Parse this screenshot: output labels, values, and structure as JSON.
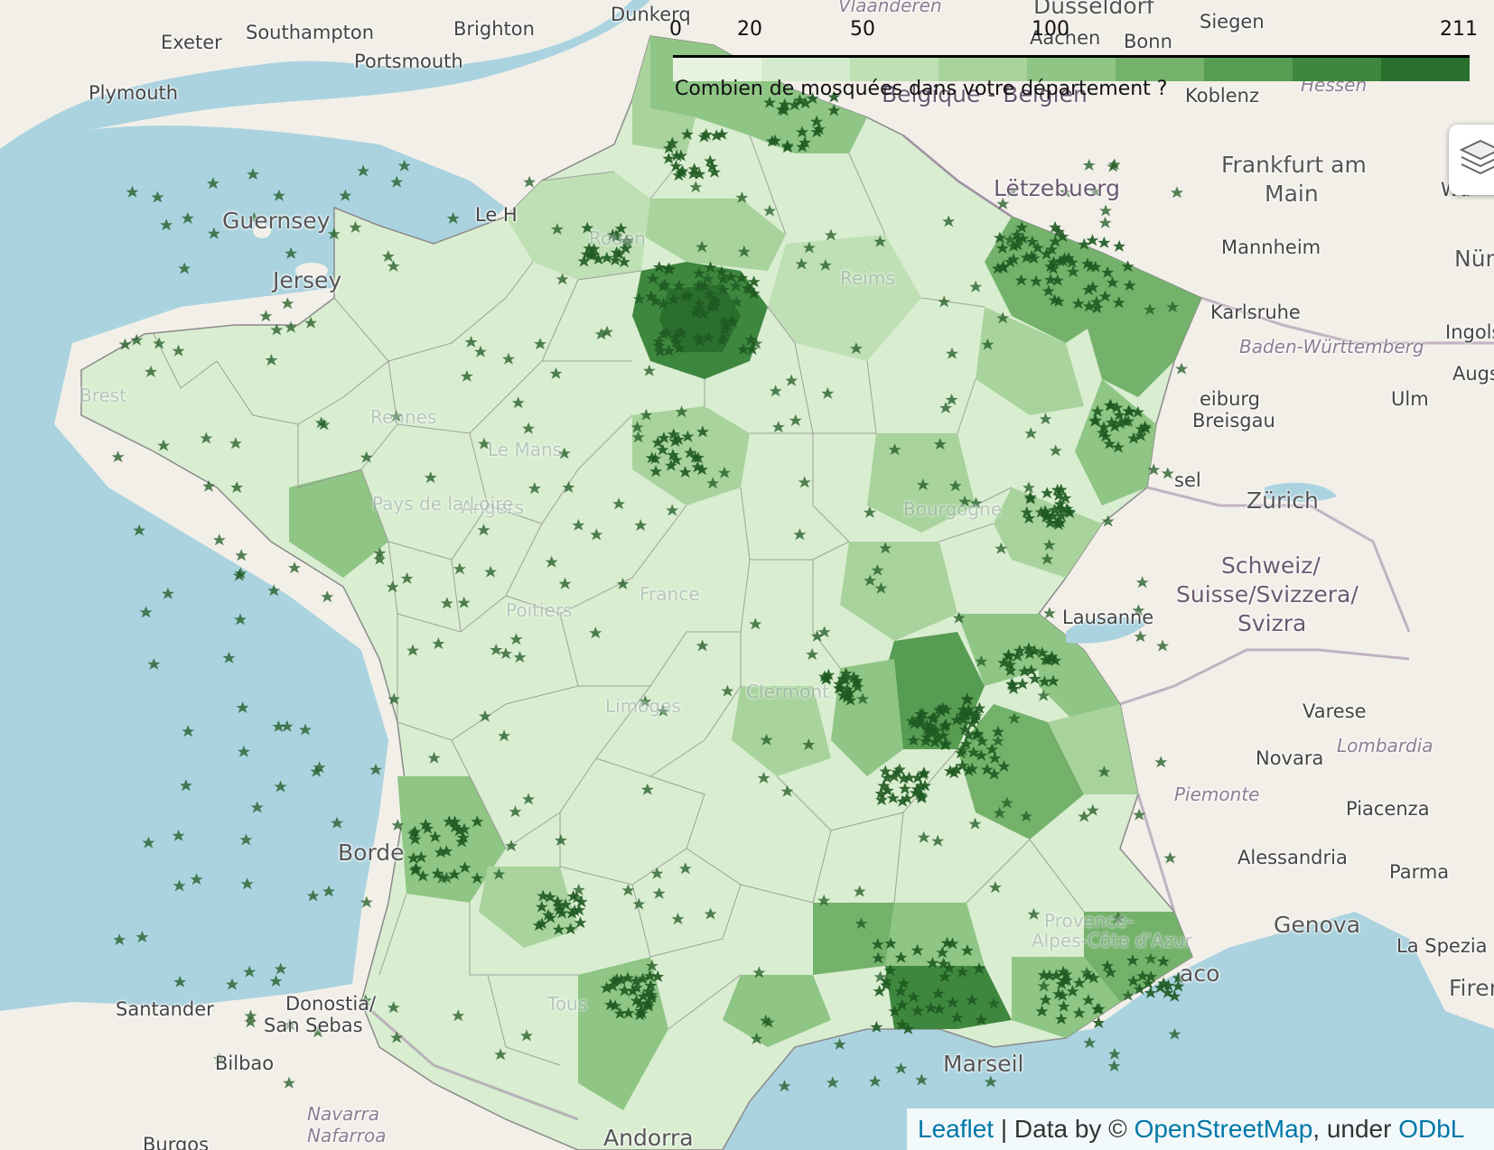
{
  "legend": {
    "ticks": [
      "0",
      "20",
      "50",
      "100",
      "211"
    ],
    "caption": "Combien de mosquées dans votre département ?",
    "colors": [
      "#e8f3e2",
      "#d5ebcd",
      "#bfe0b5",
      "#a8d39c",
      "#8fc585",
      "#74b26c",
      "#579c53",
      "#3e873f",
      "#2b6f2e"
    ]
  },
  "place_labels": {
    "exeter": "Exeter",
    "southampton": "Southampton",
    "brighton": "Brighton",
    "portsmouth": "Portsmouth",
    "plymouth": "Plymouth",
    "guernsey": "Guernsey",
    "jersey": "Jersey",
    "le_havre": "Le H",
    "dunkerque": "Dunkerq",
    "vlaanderen": "Vlaanderen",
    "dusseldorf": "Düsseldorf",
    "siegen": "Siegen",
    "aachen": "Aachen",
    "bonn": "Bonn",
    "hessen": "Hessen",
    "koblenz": "Koblenz",
    "belgien": "Belgique - Belgien",
    "frankfurt_1": "Frankfurt am",
    "frankfurt_2": "Main",
    "letzebuerg": "Lëtzebuerg",
    "wurzburg": "Wü",
    "mannheim": "Mannheim",
    "nurnberg": "Nür",
    "karlsruhe": "Karlsruhe",
    "ingolstadt": "Ingols",
    "baden": "Baden-Württemberg",
    "augsburg": "Augs",
    "ulm": "Ulm",
    "freiburg_1": "eiburg",
    "freiburg_2": "Breisgau",
    "basel": "sel",
    "zurich": "Zürich",
    "schweiz_1": "Schweiz/",
    "schweiz_2": "Suisse/Svizzera/",
    "schweiz_3": "Svizra",
    "lausanne": "Lausanne",
    "varese": "Varese",
    "lombardia": "Lombardia",
    "novara": "Novara",
    "piemonte": "Piemonte",
    "piacenza": "Piacenza",
    "alessandria": "Alessandria",
    "parma": "Parma",
    "genova": "Genova",
    "la_spezia": "La Spezia",
    "firenze": "Firen",
    "monaco": "aco",
    "marseille": "Marseil",
    "bordeaux": "Borde",
    "santander": "Santander",
    "donostia_1": "Donostia/",
    "donostia_2": "San Sebas",
    "bilbao": "Bilbao",
    "navarra": "Navarra",
    "nafarroa": "Nafarroa",
    "burgos": "Burgos",
    "andorra": "Andorra",
    "brest": "Brest",
    "reims": "Reims",
    "rennes": "Rennes",
    "le_mans": "Le Mans",
    "angers": "Angers",
    "poitiers": "Poitiers",
    "limoges": "Limoges",
    "clermont": "Clermont",
    "toulouse": "Tous",
    "bourgogne": "Bourgogne",
    "pays_loire": "Pays de la Loire",
    "france": "France",
    "alps": "Alpes-Côte d'Azur",
    "provence": "Provence-",
    "rouen": "Rouen"
  },
  "attribution": {
    "leaflet": "Leaflet",
    "separator": " | Data by © ",
    "osm": "OpenStreetMap",
    "under": ", under ",
    "odbl": "ODbL"
  },
  "icons": {
    "layers": "layers-icon",
    "mosque_marker": "crescent-star-icon"
  }
}
